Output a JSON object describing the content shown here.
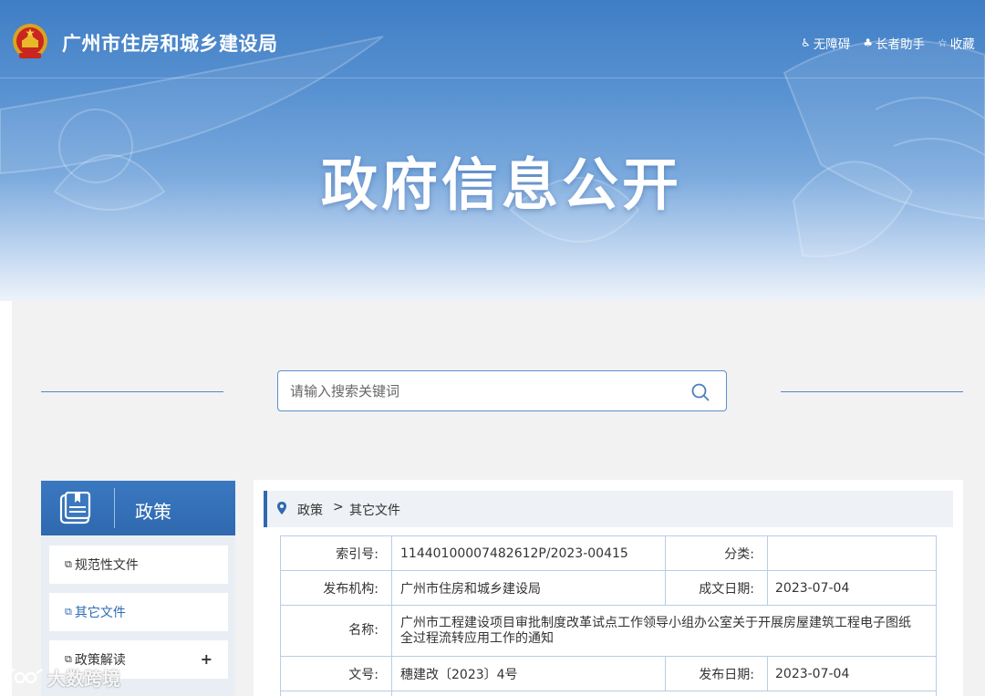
{
  "header": {
    "site_title": "广州市住房和城乡建设局",
    "links": [
      {
        "icon": "wheelchair-icon",
        "label": "无障碍"
      },
      {
        "icon": "elder-helper-icon",
        "label": "长者助手"
      },
      {
        "icon": "star-icon",
        "label": "收藏"
      }
    ],
    "banner_title": "政府信息公开"
  },
  "search": {
    "placeholder": "请输入搜索关键词",
    "icon": "search-icon"
  },
  "sidebar": {
    "title": "政策",
    "items": [
      {
        "label": "规范性文件",
        "active": false
      },
      {
        "label": "其它文件",
        "active": true
      },
      {
        "label": "政策解读",
        "active": false,
        "expand": "+"
      }
    ]
  },
  "breadcrumb": {
    "items": [
      "政策",
      "其它文件"
    ],
    "separator": ">"
  },
  "document": {
    "index_label": "索引号:",
    "index_value": "11440100007482612P/2023-00415",
    "category_label": "分类:",
    "category_value": "",
    "publisher_label": "发布机构:",
    "publisher_value": "广州市住房和城乡建设局",
    "created_label": "成文日期:",
    "created_value": "2023-07-04",
    "name_label": "名称:",
    "name_line1": "广州市工程建设项目审批制度改革试点工作领导小组办公室关于开展房屋建筑工程电子图纸",
    "name_line2": "全过程流转应用工作的通知",
    "docno_label": "文号:",
    "docno_value": "穗建改〔2023〕4号",
    "published_label": "发布日期:",
    "published_value": "2023-07-04"
  },
  "watermark": "大数跨境",
  "colors": {
    "primary": "#2f69b0",
    "banner_top": "#3f7dc4",
    "panel_bg": "#f2f2f2",
    "table_border": "#b8cde6"
  }
}
